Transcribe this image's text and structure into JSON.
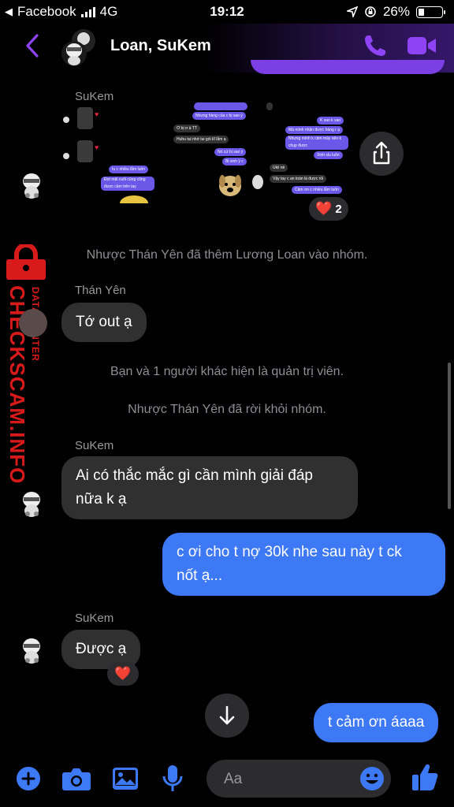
{
  "status_bar": {
    "carrier": "Facebook",
    "network": "4G",
    "time": "19:12",
    "battery": "26%",
    "battery_level": 0.26
  },
  "header": {
    "title": "Loan, SuKem",
    "back_icon": "chevron-left-icon",
    "call_icon": "phone-icon",
    "video_icon": "video-camera-icon"
  },
  "colors": {
    "accent": "#8e44f5",
    "my_bubble": "#3d78f5",
    "their_bubble": "#303030",
    "watermark": "#d91a1a"
  },
  "watermark": {
    "line1": "DATA CENTER",
    "line2": "CHECKSCAM.INFO"
  },
  "messages": [
    {
      "type": "sender",
      "text": "SuKem"
    },
    {
      "type": "image",
      "reaction": "❤️",
      "reaction_count": "2"
    },
    {
      "type": "system",
      "text": "Nhược Thán Yên đã thêm Lương Loan vào nhóm."
    },
    {
      "type": "sender",
      "text": "Thán Yên"
    },
    {
      "type": "incoming",
      "text": "Tớ out ạ"
    },
    {
      "type": "system",
      "text": "Bạn và 1 người khác hiện là quản trị viên."
    },
    {
      "type": "system",
      "text": "Nhược Thán Yên đã rời khỏi nhóm."
    },
    {
      "type": "sender",
      "text": "SuKem"
    },
    {
      "type": "incoming",
      "line1": "Ai có thắc mắc gì cần mình giải đáp",
      "line2": "nữa k ạ"
    },
    {
      "type": "outgoing",
      "line1": "c ơi cho t nợ 30k nhe sau này t ck",
      "line2": "nốt ạ..."
    },
    {
      "type": "sender",
      "text": "SuKem"
    },
    {
      "type": "incoming",
      "text": "Được ạ",
      "reaction": "❤️"
    },
    {
      "type": "outgoing",
      "text": "t cảm ơn áaaa"
    }
  ],
  "screenshot_snippets": {
    "r1": "Nhưng hàng của c bị sao ý",
    "r2": "Ơ bị ơ à TT",
    "r3": "Huhu tui nhớ tui gói kĩ lắm ạ",
    "r4": "Nó cứ bị sao ý",
    "r5": "Bị xinh ý c",
    "r6": "Ukii nè",
    "r7": "Vậy tay c an toàn là được rồi",
    "r8": "Cảm ơn c nhiều lắm luôn",
    "l1": "K sao k sao",
    "l2": "Mà mình nhận được hàng r ạ",
    "l3": "Nhưng mình k cầm máy nên k chụp được",
    "l4": "Xinh xỉu luôn",
    "l5": "Iu c nhiều lắm luôn",
    "l6": "Đợi mãi cuối cùng cũng được cầm trên tay"
  },
  "composer": {
    "placeholder": "Aa",
    "icons": [
      "plus-icon",
      "camera-icon",
      "photo-icon",
      "microphone-icon",
      "emoji-icon",
      "thumbs-up-icon"
    ]
  }
}
